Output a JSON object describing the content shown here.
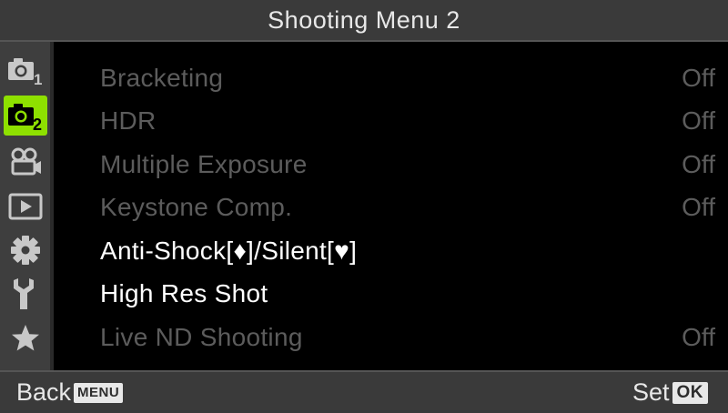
{
  "title": "Shooting Menu 2",
  "sidebar": {
    "tabs": [
      {
        "icon": "camera-1-icon",
        "badge": "1",
        "active": false
      },
      {
        "icon": "camera-2-icon",
        "badge": "2",
        "active": true
      },
      {
        "icon": "video-camera-icon",
        "active": false
      },
      {
        "icon": "playback-icon",
        "active": false
      },
      {
        "icon": "gear-icon",
        "active": false
      },
      {
        "icon": "wrench-icon",
        "active": false
      },
      {
        "icon": "star-icon",
        "active": false
      }
    ],
    "active_color": "#8ee000"
  },
  "menu": {
    "items": [
      {
        "label": "Bracketing",
        "value": "Off",
        "enabled": false
      },
      {
        "label": "HDR",
        "value": "Off",
        "enabled": false
      },
      {
        "label": "Multiple Exposure",
        "value": "Off",
        "enabled": false
      },
      {
        "label": "Keystone Comp.",
        "value": "Off",
        "enabled": false
      },
      {
        "label": "Anti-Shock[♦]/Silent[♥]",
        "value": "",
        "enabled": true
      },
      {
        "label": "High Res Shot",
        "value": "",
        "enabled": true
      },
      {
        "label": "Live ND Shooting",
        "value": "Off",
        "enabled": false
      }
    ]
  },
  "footer": {
    "back_label": "Back",
    "back_key": "MENU",
    "set_label": "Set",
    "set_key": "OK"
  }
}
